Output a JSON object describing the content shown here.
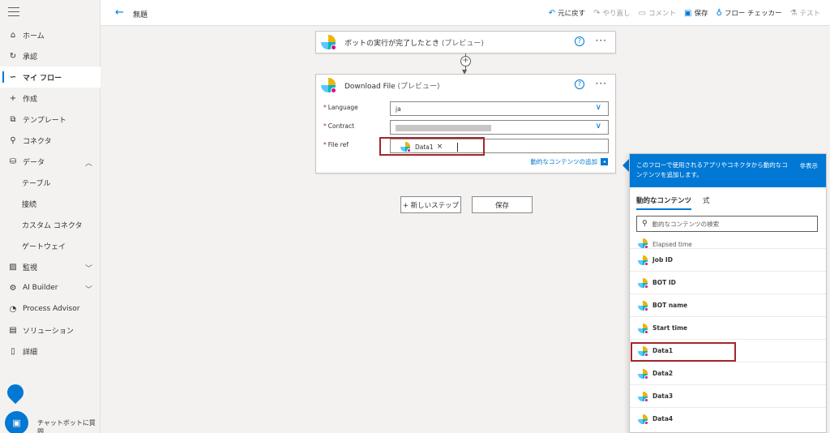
{
  "sidebar": {
    "items": [
      {
        "label": "ホーム",
        "icon": "home-icon",
        "glyph": "⌂"
      },
      {
        "label": "承認",
        "icon": "approval-icon",
        "glyph": "↻"
      },
      {
        "label": "マイ フロー",
        "icon": "flow-icon",
        "glyph": "∽",
        "active": true
      },
      {
        "label": "作成",
        "icon": "plus-icon",
        "glyph": "+"
      },
      {
        "label": "テンプレート",
        "icon": "template-icon",
        "glyph": "⧉"
      },
      {
        "label": "コネクタ",
        "icon": "connector-icon",
        "glyph": "⚲"
      },
      {
        "label": "データ",
        "icon": "database-icon",
        "glyph": "⛁",
        "expanded": true
      },
      {
        "label": "テーブル",
        "sub": true
      },
      {
        "label": "接続",
        "sub": true
      },
      {
        "label": "カスタム コネクタ",
        "sub": true
      },
      {
        "label": "ゲートウェイ",
        "sub": true
      },
      {
        "label": "監視",
        "icon": "monitor-icon",
        "glyph": "▨",
        "collapsed": true
      },
      {
        "label": "AI Builder",
        "icon": "ai-builder-icon",
        "glyph": "⚙",
        "collapsed": true
      },
      {
        "label": "Process Advisor",
        "icon": "process-advisor-icon",
        "glyph": "◔"
      },
      {
        "label": "ソリューション",
        "icon": "solution-icon",
        "glyph": "▤"
      },
      {
        "label": "詳細",
        "icon": "book-icon",
        "glyph": "▯"
      }
    ],
    "chatbot_label": "チャットボットに質問"
  },
  "header": {
    "title": "無題",
    "toolbar": {
      "undo": "元に戻す",
      "redo": "やり直し",
      "comment": "コメント",
      "save": "保存",
      "checker": "フロー チェッカー",
      "test": "テスト"
    }
  },
  "trigger_card": {
    "title": "ボットの実行が完了したとき",
    "suffix": "(プレビュー)"
  },
  "action_card": {
    "title": "Download File",
    "suffix": "(プレビュー)",
    "fields": {
      "language_label": "Language",
      "language_value": "ja",
      "contract_label": "Contract",
      "fileref_label": "File ref",
      "fileref_token": "Data1"
    },
    "dynamic_add": "動的なコンテンツの追加"
  },
  "buttons": {
    "new_step": "+ 新しいステップ",
    "save": "保存"
  },
  "dynamic_panel": {
    "banner": "このフローで使用されるアプリやコネクタから動的なコンテンツを追加します。",
    "hide": "非表示",
    "tab_dynamic": "動的なコンテンツ",
    "tab_expression": "式",
    "search_placeholder": "動的なコンテンツの検索",
    "items": [
      "Elapsed time",
      "Job ID",
      "BOT ID",
      "BOT name",
      "Start time",
      "Data1",
      "Data2",
      "Data3",
      "Data4"
    ]
  }
}
